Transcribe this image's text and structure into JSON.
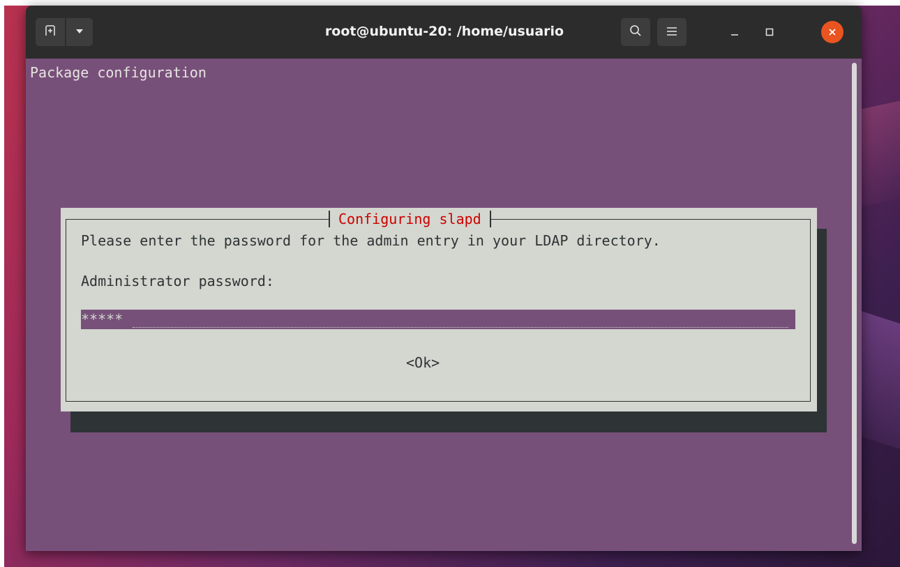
{
  "window": {
    "title": "root@ubuntu-20: /home/usuario"
  },
  "terminal": {
    "header_text": "Package configuration"
  },
  "dialog": {
    "title": "Configuring slapd",
    "message": "Please enter the password for the admin entry in your LDAP directory.",
    "password_label": "Administrator password:",
    "password_value": "*****",
    "ok_label": "<Ok>"
  },
  "colors": {
    "terminal_bg": "#77507a",
    "dialog_bg": "#d3d7cf",
    "dialog_title": "#cc0000",
    "close_button": "#e95420"
  },
  "icons": {
    "new_tab": "new-tab-icon",
    "tab_menu": "chevron-down-icon",
    "search": "search-icon",
    "menu": "hamburger-menu-icon",
    "minimize": "minimize-icon",
    "maximize": "maximize-icon",
    "close": "close-icon"
  }
}
